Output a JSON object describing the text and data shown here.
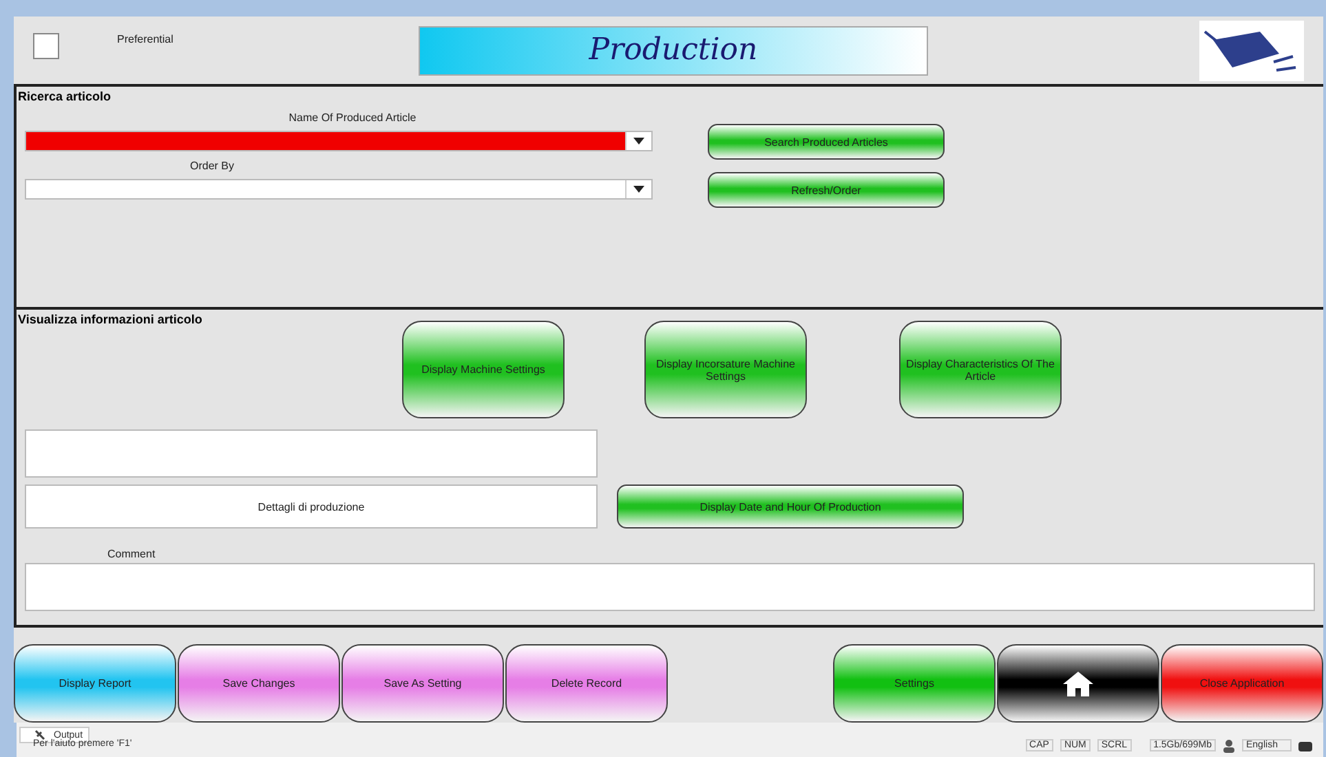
{
  "header": {
    "preferential": {
      "label": "Preferential",
      "checked": false
    },
    "title": "Production"
  },
  "search_section": {
    "title": "Ricerca articolo",
    "fields": [
      {
        "label": "Name Of Produced Article",
        "invalid": true,
        "button": "Search Produced Articles"
      },
      {
        "label": "Order By",
        "invalid": false,
        "button": "Refresh/Order"
      }
    ]
  },
  "info_section": {
    "title": "Visualizza informazioni articolo",
    "buttons": [
      "Display Machine Settings",
      "Display Incorsature Machine Settings",
      "Display Characteristics Of The Article"
    ],
    "details_value": "Dettagli di produzione",
    "date_button": "Display Date and Hour Of Production",
    "comment_label": "Comment"
  },
  "actions_left": [
    {
      "kind": "text",
      "label": "Display Report",
      "color": "#22c4f0"
    },
    {
      "kind": "text",
      "label": "Save Changes",
      "color": "#e67ee6"
    },
    {
      "kind": "text",
      "label": "Save As Setting",
      "color": "#e67ee6"
    },
    {
      "kind": "text",
      "label": "Delete Record",
      "color": "#e67ee6"
    }
  ],
  "actions_right": [
    {
      "kind": "text",
      "label": "Settings",
      "color": "#12c012"
    },
    {
      "kind": "home",
      "color": "#000000"
    },
    {
      "kind": "text",
      "label": "Close Application",
      "color": "#f01010"
    }
  ],
  "status_bar": {
    "tab": "Output",
    "hint": "Per l'aiuto premere 'F1'",
    "indicators": [
      "CAP",
      "NUM",
      "SCRL"
    ],
    "memory": "1.5Gb/699Mb",
    "language": "English"
  }
}
